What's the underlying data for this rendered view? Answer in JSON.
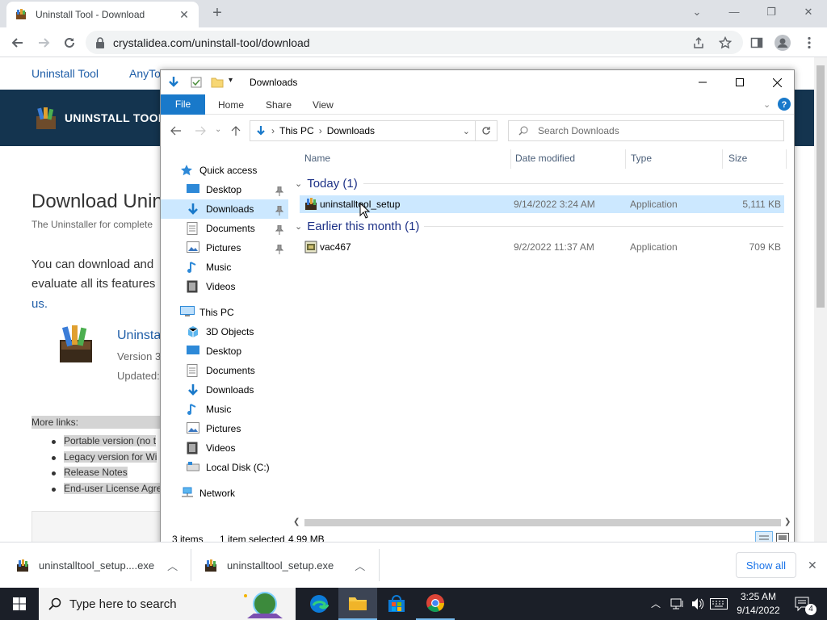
{
  "browser": {
    "tab_title": "Uninstall Tool - Download",
    "url": "crystalidea.com/uninstall-tool/download",
    "new_tab": "+",
    "tab_close": "✕"
  },
  "webpage": {
    "nav_link_1": "Uninstall Tool",
    "nav_link_2": "AnyTo",
    "banner_title": "UNINSTALL TOOL",
    "heading": "Download Unin",
    "subheading": "The Uninstaller for complete",
    "para_line1": "You can download and",
    "para_line2": "evaluate all its features",
    "para_link": "us.",
    "product_name": "Uninsta",
    "product_version": "Version 3",
    "product_updated": "Updated:",
    "more_links_label": "More links:",
    "links": [
      "Portable version (no t",
      "Legacy version for Wi",
      "Release Notes",
      "End-user License Agre"
    ]
  },
  "explorer": {
    "title": "Downloads",
    "ribbon_tabs": [
      "File",
      "Home",
      "Share",
      "View"
    ],
    "address": {
      "root": "This PC",
      "sep": "›",
      "folder": "Downloads"
    },
    "search_placeholder": "Search Downloads",
    "nav": {
      "quick_access": "Quick access",
      "qa_items": [
        "Desktop",
        "Downloads",
        "Documents",
        "Pictures",
        "Music",
        "Videos"
      ],
      "this_pc": "This PC",
      "pc_items": [
        "3D Objects",
        "Desktop",
        "Documents",
        "Downloads",
        "Music",
        "Pictures",
        "Videos",
        "Local Disk (C:)"
      ],
      "network": "Network"
    },
    "columns": {
      "name": "Name",
      "date": "Date modified",
      "type": "Type",
      "size": "Size"
    },
    "groups": [
      {
        "label": "Today (1)",
        "files": [
          {
            "name": "uninstalltool_setup",
            "date": "9/14/2022 3:24 AM",
            "type": "Application",
            "size": "5,111 KB"
          }
        ]
      },
      {
        "label": "Earlier this month (1)",
        "files": [
          {
            "name": "vac467",
            "date": "9/2/2022 11:37 AM",
            "type": "Application",
            "size": "709 KB"
          }
        ]
      }
    ],
    "status": {
      "items": "3 items",
      "selected": "1 item selected",
      "size": "4.99 MB"
    }
  },
  "downloads_bar": {
    "items": [
      "uninstalltool_setup....exe",
      "uninstalltool_setup.exe"
    ],
    "show_all": "Show all"
  },
  "taskbar": {
    "search_placeholder": "Type here to search",
    "time": "3:25 AM",
    "date": "9/14/2022",
    "notifications": "4"
  },
  "colors": {
    "accent": "#1979ca",
    "selection": "#cce8ff",
    "banner": "#14344f",
    "taskbar": "#1b1f28"
  }
}
